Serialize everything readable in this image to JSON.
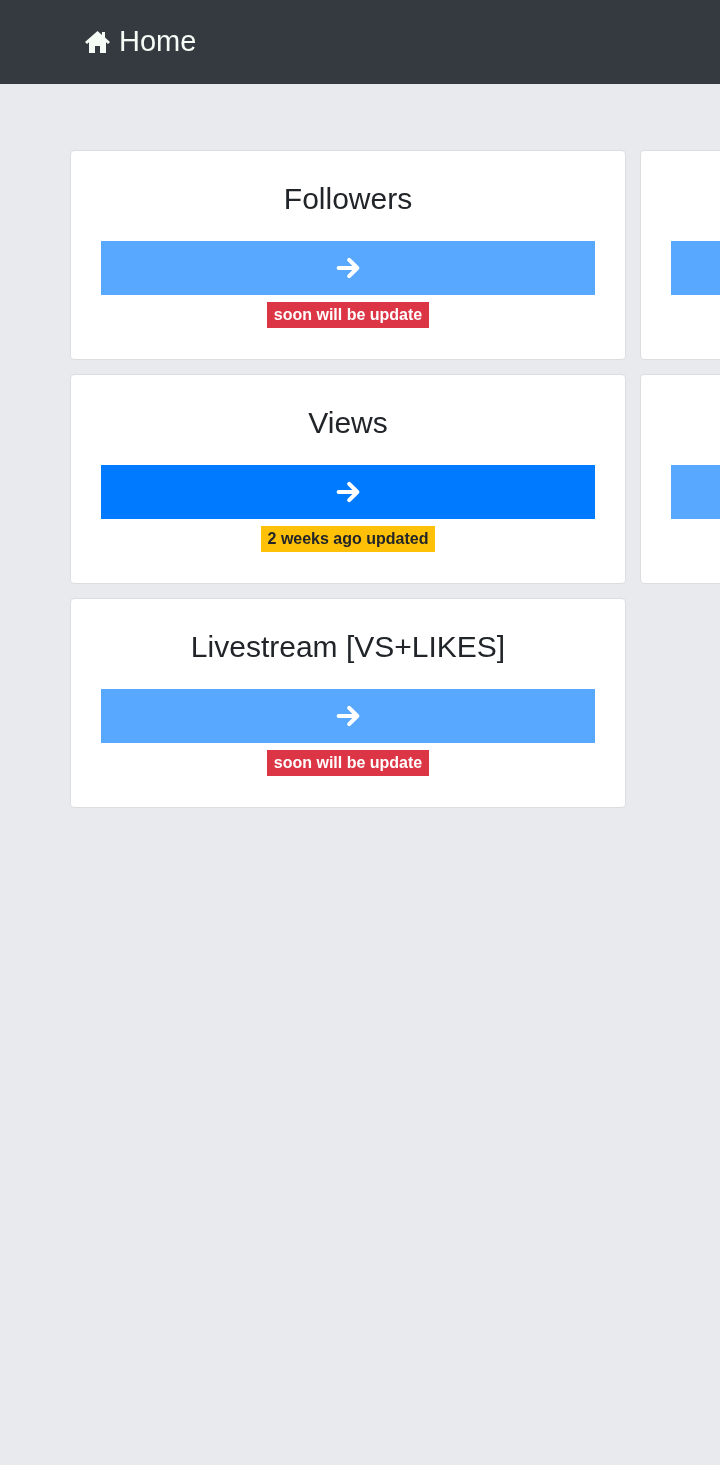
{
  "navbar": {
    "brand": "Home"
  },
  "cards": [
    {
      "title": "Followers",
      "disabled": true,
      "badge": {
        "text": "soon will be update",
        "kind": "danger"
      }
    },
    {
      "disabled": true
    },
    {
      "title": "Views",
      "disabled": false,
      "badge": {
        "text": "2 weeks ago updated",
        "kind": "warning"
      }
    },
    {
      "disabled": true
    },
    {
      "title": "Livestream [VS+LIKES]",
      "disabled": true,
      "badge": {
        "text": "soon will be update",
        "kind": "danger"
      }
    }
  ]
}
